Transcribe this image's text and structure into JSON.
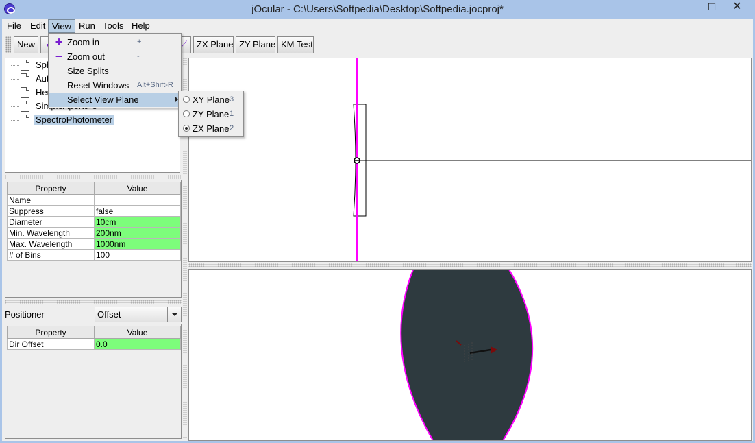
{
  "window": {
    "title": "jOcular - C:\\Users\\Softpedia\\Desktop\\Softpedia.jocproj*",
    "minimize_glyph": "—",
    "maximize_glyph": "☐",
    "close_glyph": "✕"
  },
  "menubar": {
    "items": [
      {
        "label": "File"
      },
      {
        "label": "Edit"
      },
      {
        "label": "View"
      },
      {
        "label": "Run"
      },
      {
        "label": "Tools"
      },
      {
        "label": "Help"
      }
    ]
  },
  "toolbar": {
    "new_label": "New",
    "zx_plane_label": "ZX Plane",
    "zy_plane_label": "ZY Plane",
    "km_test_label": "KM Test"
  },
  "tree": {
    "items": [
      {
        "label": "Sph"
      },
      {
        "label": "Auto"
      },
      {
        "label": "Hem"
      },
      {
        "label": "SimpleAperture"
      },
      {
        "label": "SpectroPhotometer",
        "selected": true
      }
    ]
  },
  "properties": {
    "header_property": "Property",
    "header_value": "Value",
    "rows": [
      {
        "name": "Name",
        "value": "",
        "highlight": false
      },
      {
        "name": "Suppress",
        "value": "false",
        "highlight": false
      },
      {
        "name": "Diameter",
        "value": "10cm",
        "highlight": true
      },
      {
        "name": "Min. Wavelength",
        "value": "200nm",
        "highlight": true
      },
      {
        "name": "Max. Wavelength",
        "value": "1000nm",
        "highlight": true
      },
      {
        "name": "# of Bins",
        "value": "100",
        "highlight": false
      }
    ]
  },
  "positioner": {
    "label": "Positioner",
    "selected": "Offset",
    "header_property": "Property",
    "header_value": "Value",
    "rows": [
      {
        "name": "Dir Offset",
        "value": "0.0",
        "highlight": true
      }
    ]
  },
  "view_menu": {
    "items": [
      {
        "label": "Zoom in",
        "accel": "+",
        "icon": "+"
      },
      {
        "label": "Zoom out",
        "accel": "-",
        "icon": "−"
      },
      {
        "label": "Size Splits",
        "accel": ""
      },
      {
        "label": "Reset Windows",
        "accel": "Alt+Shift-R"
      },
      {
        "label": "Select View Plane",
        "accel": ""
      }
    ]
  },
  "view_plane_submenu": {
    "items": [
      {
        "label": "XY Plane",
        "accel": "3",
        "checked": false
      },
      {
        "label": "ZY Plane",
        "accel": "1",
        "checked": false
      },
      {
        "label": "ZX Plane",
        "accel": "2",
        "checked": true
      }
    ]
  },
  "colors": {
    "axis_magenta": "#ff00ff",
    "highlight_green": "#7dfd7b",
    "menu_highlight": "#b8cfe5",
    "lens_fill": "#2e3a3f",
    "icon_purple": "#7a1fd0"
  }
}
